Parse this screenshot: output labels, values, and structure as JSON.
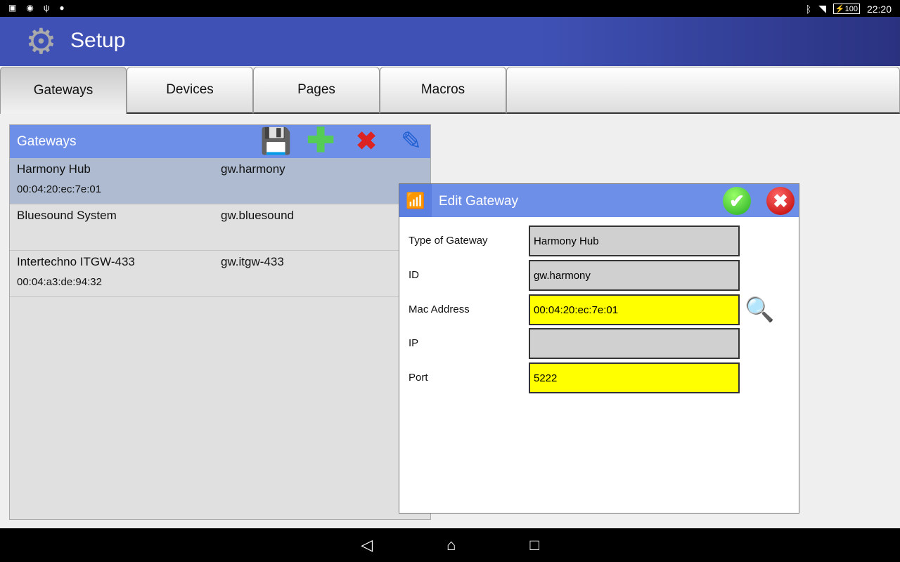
{
  "status": {
    "time": "22:20",
    "battery": "100"
  },
  "app": {
    "title": "Setup"
  },
  "tabs": [
    {
      "label": "Gateways"
    },
    {
      "label": "Devices"
    },
    {
      "label": "Pages"
    },
    {
      "label": "Macros"
    }
  ],
  "panel": {
    "title": "Gateways",
    "items": [
      {
        "name": "Harmony Hub",
        "id": "gw.harmony",
        "mac": "00:04:20:ec:7e:01"
      },
      {
        "name": "Bluesound System",
        "id": "gw.bluesound",
        "mac": ""
      },
      {
        "name": "Intertechno ITGW-433",
        "id": "gw.itgw-433",
        "mac": "00:04:a3:de:94:32"
      }
    ]
  },
  "dialog": {
    "title": "Edit Gateway",
    "fields": [
      {
        "label": "Type of Gateway",
        "value": "Harmony Hub"
      },
      {
        "label": "ID",
        "value": "gw.harmony"
      },
      {
        "label": "Mac Address",
        "value": "00:04:20:ec:7e:01"
      },
      {
        "label": "IP",
        "value": ""
      },
      {
        "label": "Port",
        "value": "5222"
      }
    ]
  }
}
